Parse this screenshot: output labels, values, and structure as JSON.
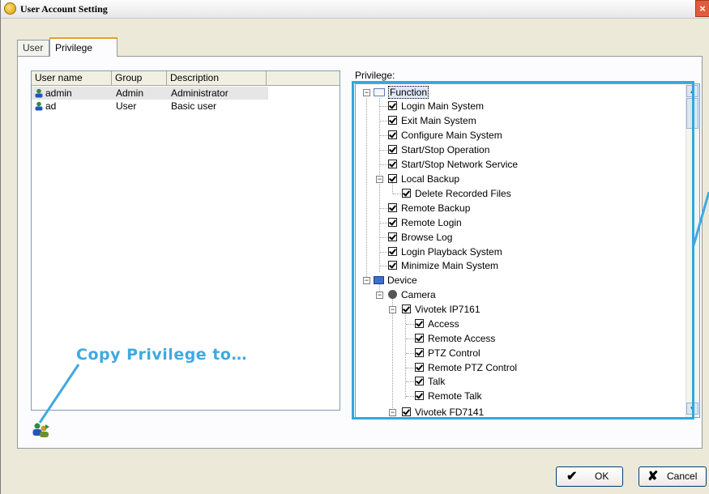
{
  "window": {
    "title": "User Account Setting",
    "close_glyph": "×"
  },
  "tabs": [
    {
      "label": "User"
    },
    {
      "label": "Privilege"
    }
  ],
  "user_list": {
    "columns": [
      "User name",
      "Group",
      "Description"
    ],
    "rows": [
      {
        "name": "admin",
        "group": "Admin",
        "description": "Administrator",
        "icon": "user-icon"
      },
      {
        "name": "ad",
        "group": "User",
        "description": "Basic user",
        "icon": "user-icon"
      }
    ]
  },
  "privilege": {
    "label": "Privilege:",
    "function": {
      "label": "Function",
      "items": [
        "Login Main System",
        "Exit Main System",
        "Configure Main System",
        "Start/Stop Operation",
        "Start/Stop Network Service",
        "Local Backup",
        "Delete Recorded Files",
        "Remote Backup",
        "Remote Login",
        "Browse Log",
        "Login Playback System",
        "Minimize Main System"
      ]
    },
    "device": {
      "label": "Device",
      "camera": "Camera",
      "cam1": {
        "label": "Vivotek IP7161",
        "items": [
          "Access",
          "Remote Access",
          "PTZ Control",
          "Remote PTZ Control",
          "Talk",
          "Remote Talk"
        ]
      },
      "cam2": {
        "label": "Vivotek FD7141"
      }
    }
  },
  "annotation": {
    "callout": "Copy Privilege to…",
    "color": "#3fa9e0"
  },
  "buttons": {
    "ok": "OK",
    "cancel": "Cancel",
    "ok_glyph": "✔",
    "cancel_glyph": "✘"
  }
}
